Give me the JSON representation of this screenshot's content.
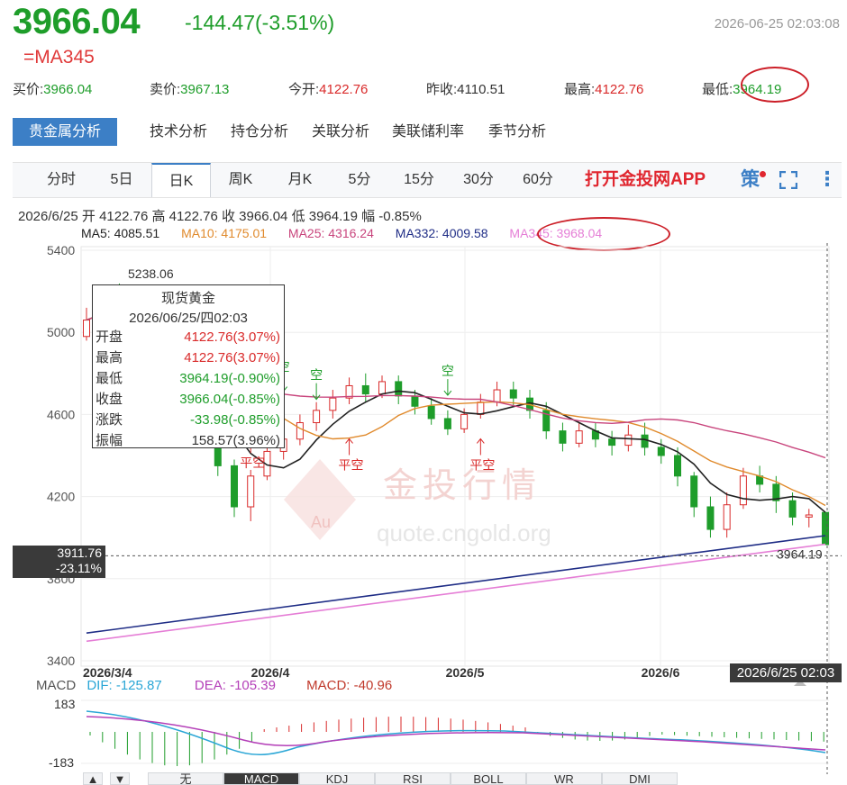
{
  "header": {
    "price": "3966.04",
    "change": "-144.47(-3.51%)",
    "datetime": "2026-06-25 02:03:08",
    "alias": "=MA345"
  },
  "quote": [
    {
      "label": "买价:",
      "value": "3966.04",
      "color": "green"
    },
    {
      "label": "卖价:",
      "value": "3967.13",
      "color": "green"
    },
    {
      "label": "今开:",
      "value": "4122.76",
      "color": "red"
    },
    {
      "label": "昨收:",
      "value": "4110.51",
      "color": "dark"
    },
    {
      "label": "最高:",
      "value": "4122.76",
      "color": "red"
    },
    {
      "label": "最低:",
      "value": "3964.19",
      "color": "green"
    }
  ],
  "tabs1": [
    "贵金属分析",
    "技术分析",
    "持仓分析",
    "关联分析",
    "美联储利率",
    "季节分析"
  ],
  "tabs2": [
    "分时",
    "5日",
    "日K",
    "周K",
    "月K",
    "5分",
    "15分",
    "30分",
    "60分"
  ],
  "app_link": "打开金投网APP",
  "strategy_icon_text": "策",
  "info_line": "2026/6/25  开 4122.76  高 4122.76  收 3966.04  低 3964.19  幅 -0.85%",
  "ma": [
    {
      "label": "MA5: 4085.51",
      "color": "#222222"
    },
    {
      "label": "MA10: 4175.01",
      "color": "#e08a2c"
    },
    {
      "label": "MA25: 4316.24",
      "color": "#c8447c"
    },
    {
      "label": "MA332: 4009.58",
      "color": "#1f2d86"
    },
    {
      "label": "MA345: 3968.04",
      "color": "#e57ed6"
    }
  ],
  "tooltip": {
    "title": "现货黄金",
    "date": "2026/06/25/四02:03",
    "rows": [
      {
        "k": "开盘",
        "v": "4122.76(3.07%)",
        "color": "red"
      },
      {
        "k": "最高",
        "v": "4122.76(3.07%)",
        "color": "red"
      },
      {
        "k": "最低",
        "v": "3964.19(-0.90%)",
        "color": "green"
      },
      {
        "k": "收盘",
        "v": "3966.04(-0.85%)",
        "color": "green"
      },
      {
        "k": "涨跌",
        "v": "-33.98(-0.85%)",
        "color": "green"
      },
      {
        "k": "振幅",
        "v": "158.57(3.96%)",
        "color": "dark"
      }
    ]
  },
  "y_badge": {
    "price": "3911.76",
    "pct": "-23.11%"
  },
  "date_badge": "2026/6/25 02:03",
  "macd": {
    "label": "MACD",
    "dif": "DIF: -125.87",
    "dea": "DEA: -105.39",
    "macd": "MACD: -40.96"
  },
  "bottom_tabs": [
    "无",
    "MACD",
    "KDJ",
    "RSI",
    "BOLL",
    "WR",
    "DMI"
  ],
  "watermark": {
    "cn": "金投行情",
    "url": "quote.cngold.org",
    "logo": "Au"
  },
  "chart_data": {
    "type": "candlestick",
    "y_axis_ticks": [
      "5400",
      "5000",
      "4600",
      "4200",
      "3800",
      "3400"
    ],
    "ylim": [
      3400,
      5400
    ],
    "x_labels": [
      "2026/3/4",
      "2026/4",
      "2026/5",
      "2026/6"
    ],
    "max_annotation": "5238.06",
    "min_annotation": "3964.19",
    "signals": [
      {
        "text": "空",
        "type": "sell",
        "x": 12,
        "price": 4810
      },
      {
        "text": "空",
        "type": "sell",
        "x": 14,
        "price": 4770
      },
      {
        "text": "空",
        "type": "sell",
        "x": 22,
        "price": 4790
      },
      {
        "text": "平空",
        "type": "cover",
        "x": 10,
        "price": 4430
      },
      {
        "text": "平空",
        "type": "cover",
        "x": 16,
        "price": 4420
      },
      {
        "text": "平空",
        "type": "cover",
        "x": 24,
        "price": 4420
      }
    ],
    "macd_ticks": [
      "183",
      "-183"
    ],
    "candles": [
      [
        4980,
        5060,
        4960,
        5120
      ],
      [
        5060,
        5120,
        5020,
        5180
      ],
      [
        5120,
        5100,
        5050,
        5238.06
      ],
      [
        5100,
        5050,
        5000,
        5140
      ],
      [
        5050,
        4960,
        4900,
        5080
      ],
      [
        4960,
        4850,
        4800,
        4980
      ],
      [
        4850,
        4700,
        4620,
        4870
      ],
      [
        4700,
        4550,
        4460,
        4720
      ],
      [
        4550,
        4350,
        4300,
        4600
      ],
      [
        4350,
        4150,
        4100,
        4380
      ],
      [
        4150,
        4300,
        4080,
        4330
      ],
      [
        4300,
        4420,
        4280,
        4460
      ],
      [
        4420,
        4480,
        4380,
        4520
      ],
      [
        4480,
        4560,
        4450,
        4600
      ],
      [
        4560,
        4620,
        4520,
        4660
      ],
      [
        4620,
        4680,
        4580,
        4720
      ],
      [
        4680,
        4740,
        4650,
        4780
      ],
      [
        4740,
        4700,
        4660,
        4800
      ],
      [
        4700,
        4760,
        4680,
        4790
      ],
      [
        4760,
        4690,
        4650,
        4790
      ],
      [
        4690,
        4640,
        4600,
        4720
      ],
      [
        4640,
        4580,
        4550,
        4680
      ],
      [
        4580,
        4530,
        4500,
        4620
      ],
      [
        4530,
        4600,
        4510,
        4630
      ],
      [
        4600,
        4660,
        4580,
        4700
      ],
      [
        4660,
        4720,
        4640,
        4760
      ],
      [
        4720,
        4680,
        4640,
        4760
      ],
      [
        4680,
        4620,
        4580,
        4720
      ],
      [
        4620,
        4520,
        4480,
        4660
      ],
      [
        4520,
        4460,
        4420,
        4560
      ],
      [
        4460,
        4520,
        4440,
        4560
      ],
      [
        4520,
        4480,
        4440,
        4560
      ],
      [
        4480,
        4450,
        4400,
        4520
      ],
      [
        4450,
        4500,
        4420,
        4550
      ],
      [
        4500,
        4440,
        4400,
        4560
      ],
      [
        4440,
        4400,
        4360,
        4480
      ],
      [
        4400,
        4300,
        4250,
        4440
      ],
      [
        4300,
        4150,
        4100,
        4320
      ],
      [
        4150,
        4040,
        4000,
        4200
      ],
      [
        4040,
        4160,
        4000,
        4220
      ],
      [
        4160,
        4300,
        4140,
        4340
      ],
      [
        4300,
        4260,
        4220,
        4350
      ],
      [
        4260,
        4180,
        4120,
        4300
      ],
      [
        4180,
        4100,
        4060,
        4220
      ],
      [
        4100,
        4110.51,
        4050,
        4140
      ],
      [
        4122.76,
        3966.04,
        3964.19,
        4122.76
      ]
    ]
  }
}
